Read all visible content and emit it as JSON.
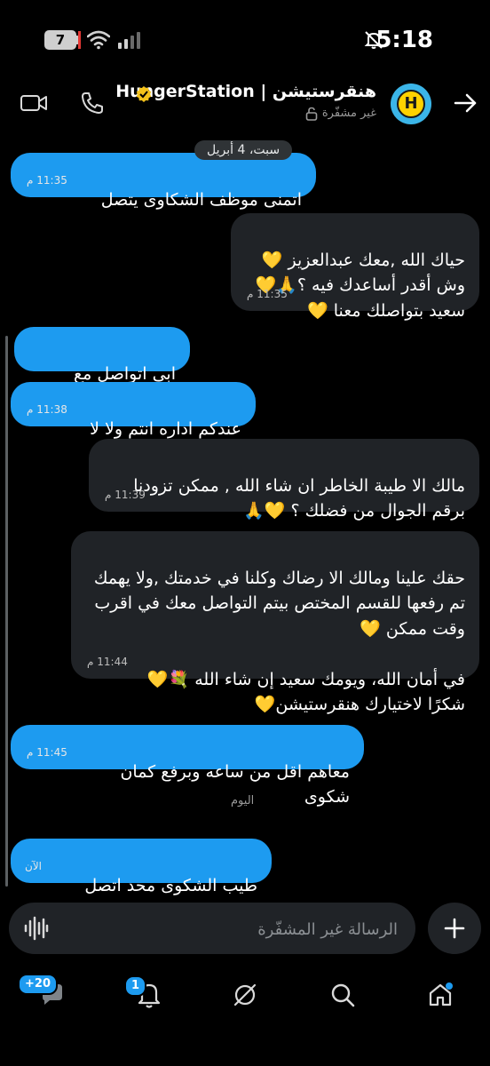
{
  "status_bar": {
    "time": "5:18",
    "battery": "7"
  },
  "header": {
    "contact_name": "هنقرستيشن | HungerStation",
    "encryption_status": "غير مشفّرة",
    "avatar_letter": "H"
  },
  "chat": {
    "date_separator": "سبت، 4 أبريل",
    "today_label": "اليوم",
    "messages": [
      {
        "direction": "out",
        "text": "اتمنى موظف الشكاوى يتصل علي",
        "time": "11:35 م"
      },
      {
        "direction": "in",
        "text": "حياك الله ,معك عبدالعزيز 💛\nوش أقدر أساعدك فيه ؟🙏💛\nسعيد بتواصلك معنا 💛",
        "time": "11:35 م"
      },
      {
        "direction": "out",
        "text": "ابي اتواصل مع الاداره",
        "time": ""
      },
      {
        "direction": "out",
        "text": "عندكم اداره انتم ولا لا .؟",
        "time": "11:38 م"
      },
      {
        "direction": "in",
        "text": "مالك الا طيبة الخاطر ان شاء الله , ممكن تزودنا برقم الجوال من فضلك ؟ 💛🙏",
        "time": "11:39 م"
      },
      {
        "direction": "in",
        "text": "حقك علينا ومالك الا رضاك وكلنا في خدمتك ,ولا يهمك تم رفعها للقسم المختص بيتم التواصل معك في اقرب وقت ممكن 💛\n\nفي أمان الله، ويومك سعيد إن شاء الله 💐💛\nشكرًا لاختيارك هنقرستيشن💛",
        "time": "11:44 م"
      },
      {
        "direction": "out",
        "text": "معاهم اقل من ساعه وبرفع كمان شكوى",
        "time": "11:45 م"
      },
      {
        "direction": "out",
        "text": "طيب الشكوى محد اتصل علي",
        "time": "الآن"
      }
    ]
  },
  "composer": {
    "placeholder": "الرسالة غير المشفّرة"
  },
  "bottom_nav": {
    "messages_badge": "+20",
    "notifications_badge": "1"
  },
  "colors": {
    "accent": "#1d9bf0",
    "incoming_bubble": "#202327",
    "background": "#000000",
    "verified": "#f4c21b"
  }
}
